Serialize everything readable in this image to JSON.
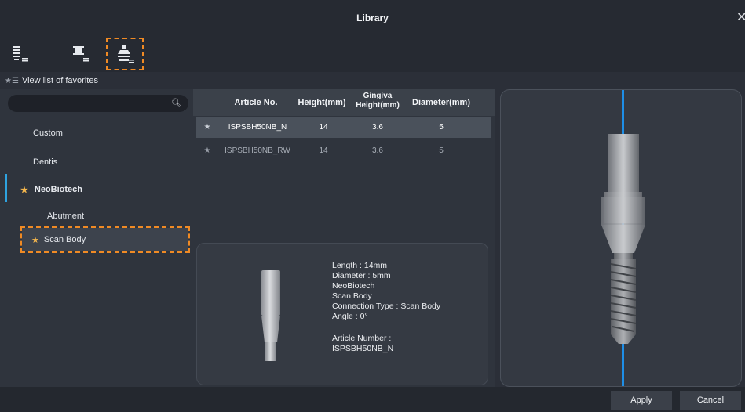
{
  "window": {
    "title": "Library",
    "close_glyph": "✕"
  },
  "toolbar": {
    "tools": [
      {
        "icon": "implant-fixture-icon"
      },
      {
        "icon": "abutment-icon"
      },
      {
        "icon": "scan-body-icon",
        "selected": true
      }
    ]
  },
  "favorites": {
    "label": "View list of favorites"
  },
  "search": {
    "placeholder": "",
    "value": ""
  },
  "sidebar": {
    "items": [
      {
        "label": "Custom",
        "starred": false
      },
      {
        "label": "Dentis",
        "starred": false
      },
      {
        "label": "NeoBiotech",
        "starred": true,
        "expanded": true
      },
      {
        "label": "Abutment",
        "starred": false,
        "child": true
      },
      {
        "label": "Scan Body",
        "starred": true,
        "child": true,
        "selected": true
      }
    ]
  },
  "table": {
    "columns": [
      "Article No.",
      "Height(mm)",
      "Gingiva Height(mm)",
      "Diameter(mm)"
    ],
    "column_gingiva_line1": "Gingiva",
    "column_gingiva_line2": "Height(mm)",
    "rows": [
      {
        "article": "ISPSBH50NB_N",
        "height": "14",
        "gingiva": "3.6",
        "diameter": "5",
        "selected": true
      },
      {
        "article": "ISPSBH50NB_RW",
        "height": "14",
        "gingiva": "3.6",
        "diameter": "5",
        "selected": false
      }
    ]
  },
  "details": {
    "length": "Length : 14mm",
    "diameter": "Diameter : 5mm",
    "brand": "NeoBiotech",
    "type": "Scan Body",
    "connection": "Connection Type : Scan Body",
    "angle": "Angle : 0°",
    "article_label": "Article Number :",
    "article_value": "ISPSBH50NB_N"
  },
  "footer": {
    "apply": "Apply",
    "cancel": "Cancel"
  },
  "colors": {
    "accent": "#f08a24",
    "axis": "#1e8ee6",
    "star": "#f4b64d",
    "selected_row": "#4a515b"
  }
}
